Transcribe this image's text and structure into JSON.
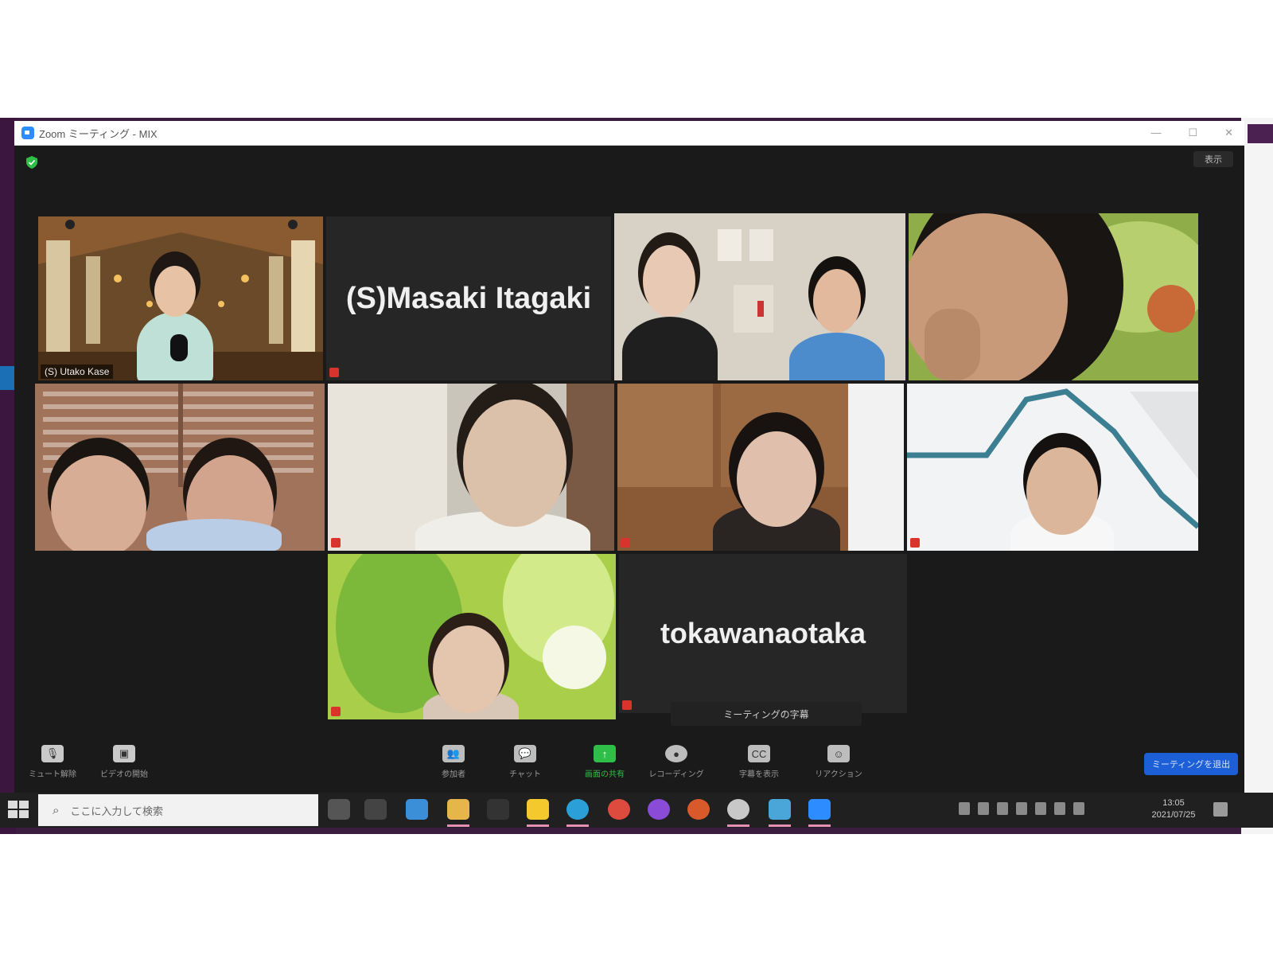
{
  "window": {
    "title": "Zoom ミーティング - MIX",
    "controls": [
      "—",
      "☐",
      "✕"
    ],
    "view_label": "表示"
  },
  "participants": [
    {
      "name": "(S) Utako Kase",
      "video": true,
      "label_visible": true
    },
    {
      "name": "(S)Masaki Itagaki",
      "video": false,
      "muted": true
    },
    {
      "name": "",
      "video": true
    },
    {
      "name": "",
      "video": true
    },
    {
      "name": "",
      "video": true,
      "active_speaker": true
    },
    {
      "name": "",
      "video": true
    },
    {
      "name": "",
      "video": true
    },
    {
      "name": "",
      "video": true
    },
    {
      "name": "",
      "video": true
    },
    {
      "name": "tokawanaotaka",
      "video": false,
      "muted": true
    }
  ],
  "toolbar": {
    "left": [
      {
        "icon": "microphone-muted-icon",
        "label": "ミュート解除"
      },
      {
        "icon": "video-off-icon",
        "label": "ビデオの開始"
      }
    ],
    "center": [
      {
        "icon": "participants-icon",
        "label": "参加者"
      },
      {
        "icon": "chat-icon",
        "label": "チャット"
      },
      {
        "icon": "share-screen-icon",
        "label": "画面の共有"
      },
      {
        "icon": "record-icon",
        "label": "レコーディング"
      },
      {
        "icon": "closed-caption-icon",
        "label": "字幕を表示"
      },
      {
        "icon": "reactions-icon",
        "label": "リアクション"
      }
    ],
    "end_label": "ミーティングを退出",
    "accent_green": "#2fbf48",
    "accent_blue": "#1d5fd6"
  },
  "caption_bar": "ミーティングの字幕",
  "taskbar": {
    "search_placeholder": "ここに入力して検索",
    "clock_time": "13:05",
    "clock_date": "2021/07/25"
  },
  "colors": {
    "active_speaker_border": "#c9d94a",
    "zoom_background": "#1a1a1a"
  }
}
